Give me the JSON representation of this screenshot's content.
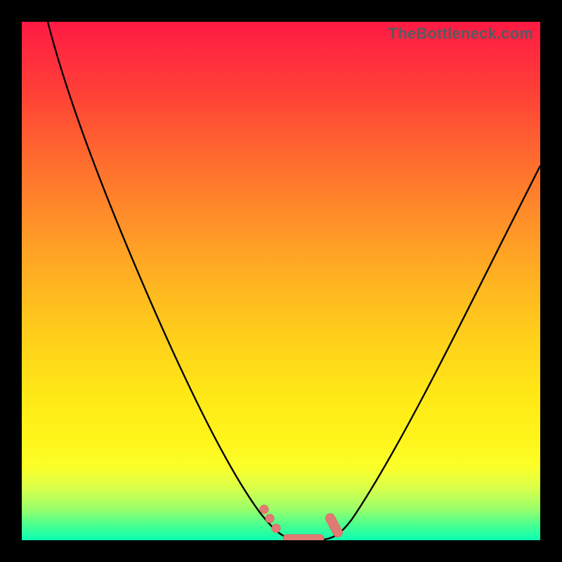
{
  "watermark": "TheBottleneck.com",
  "colors": {
    "frame": "#000000",
    "curve_stroke": "#000000",
    "marker_fill": "#e27a74",
    "gradient_top": "#ff1a44",
    "gradient_bottom": "#0affb3"
  },
  "chart_data": {
    "type": "line",
    "title": "",
    "xlabel": "",
    "ylabel": "",
    "xlim": [
      0,
      100
    ],
    "ylim": [
      0,
      100
    ],
    "annotations": [],
    "series": [
      {
        "name": "bottleneck-curve-left",
        "x": [
          5,
          10,
          15,
          20,
          25,
          30,
          35,
          40,
          45,
          48,
          50,
          52
        ],
        "values": [
          100,
          89,
          77,
          66,
          54,
          43,
          31,
          20,
          8,
          3,
          1,
          0
        ]
      },
      {
        "name": "bottleneck-curve-right",
        "x": [
          58,
          60,
          65,
          70,
          75,
          80,
          85,
          90,
          95,
          100
        ],
        "values": [
          0,
          2,
          10,
          19,
          28,
          37,
          46,
          54,
          63,
          72
        ]
      },
      {
        "name": "optimum-flat",
        "x": [
          52,
          53,
          54,
          55,
          56,
          57,
          58
        ],
        "values": [
          0,
          0,
          0,
          0,
          0,
          0,
          0
        ]
      }
    ],
    "markers": [
      {
        "name": "left-dot-1",
        "x": 47.0,
        "y": 5.0
      },
      {
        "name": "left-dot-2",
        "x": 48.0,
        "y": 3.0
      },
      {
        "name": "left-dot-3",
        "x": 49.5,
        "y": 1.0
      },
      {
        "name": "flat-dot-1",
        "x": 51.0,
        "y": 0.0
      },
      {
        "name": "flat-dot-2",
        "x": 53.0,
        "y": 0.0
      },
      {
        "name": "flat-dot-3",
        "x": 55.0,
        "y": 0.0
      },
      {
        "name": "flat-dot-4",
        "x": 57.0,
        "y": 0.0
      },
      {
        "name": "right-dot-1",
        "x": 59.0,
        "y": 1.0
      },
      {
        "name": "right-dot-2",
        "x": 60.0,
        "y": 3.0
      },
      {
        "name": "right-dot-3",
        "x": 60.5,
        "y": 5.0
      }
    ]
  }
}
